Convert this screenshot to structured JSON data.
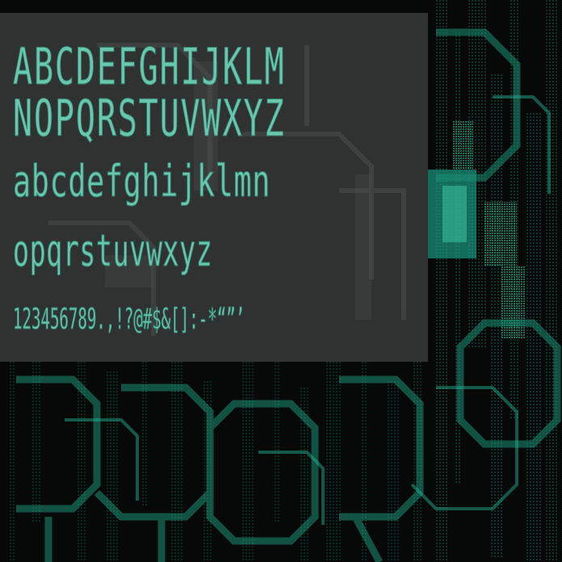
{
  "specimen": {
    "uppercase_line_1": "ABCDEFGHIJKLM",
    "uppercase_line_2": "NOPQRSTUVWXYZ",
    "lowercase_line_1": "abcdefghijklmn",
    "lowercase_line_2": "opqrstuvwxyz",
    "numerals_symbols": "123456789.,!?@#$&[]:-*“”’"
  },
  "colors": {
    "glyph": "#69c7ad",
    "panel": "#343636",
    "background": "#060908",
    "accent_teal": "#1fa889"
  }
}
